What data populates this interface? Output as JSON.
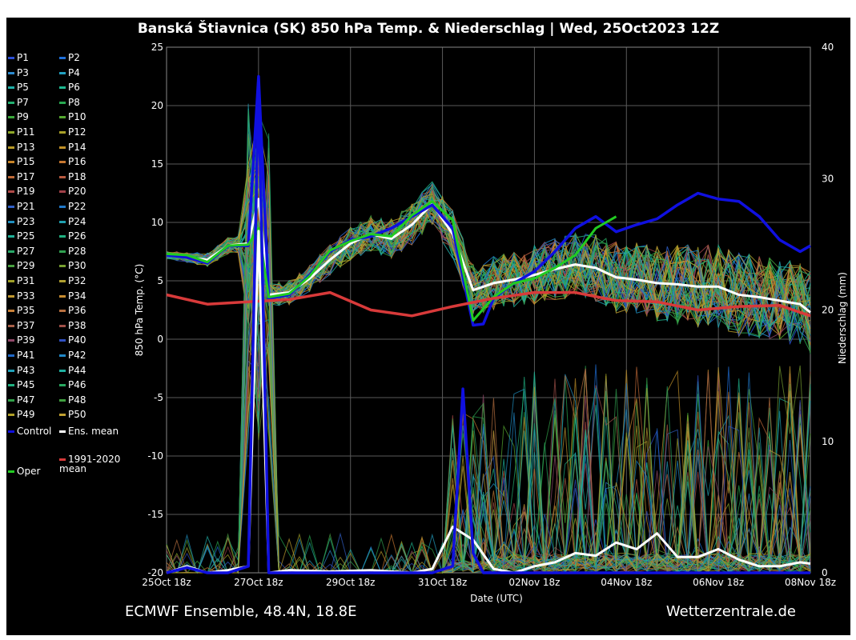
{
  "title": "Banská Štiavnica  (SK)  850 hPa Temp. & Niederschlag | Wed, 25Oct2023 12Z",
  "footer": {
    "model": "ECMWF Ensemble, 48.4N, 18.8E",
    "source": "Wetterzentrale.de"
  },
  "colors": {
    "background": "#000000",
    "grid": "#5a5a5a",
    "control": "#1010e0",
    "ens_mean": "#ffffff",
    "climate_mean": "#d83a3a",
    "oper": "#22cc22"
  },
  "legend": {
    "members": [
      "P1",
      "P2",
      "P3",
      "P4",
      "P5",
      "P6",
      "P7",
      "P8",
      "P9",
      "P10",
      "P11",
      "P12",
      "P13",
      "P14",
      "P15",
      "P16",
      "P17",
      "P18",
      "P19",
      "P20",
      "P21",
      "P22",
      "P23",
      "P24",
      "P25",
      "P26",
      "P27",
      "P28",
      "P29",
      "P30",
      "P31",
      "P32",
      "P33",
      "P34",
      "P35",
      "P36",
      "P37",
      "P38",
      "P39",
      "P40",
      "P41",
      "P42",
      "P43",
      "P44",
      "P45",
      "P46",
      "P47",
      "P48",
      "P49",
      "P50"
    ],
    "member_colors": [
      "#2c4fd6",
      "#1f6fd8",
      "#2b8ad0",
      "#22a0c0",
      "#20b0a8",
      "#1fb890",
      "#22b070",
      "#28a850",
      "#3aa83a",
      "#55a830",
      "#8ea828",
      "#a8a028",
      "#b89a28",
      "#c09028",
      "#c88428",
      "#c87830",
      "#c06a38",
      "#b85a40",
      "#b04a48",
      "#a04048",
      "#3060c8",
      "#2078c8",
      "#2090c0",
      "#20a0b0",
      "#20b098",
      "#20b080",
      "#28a868",
      "#30a050",
      "#48a040",
      "#78a030",
      "#a0a028",
      "#b0a030",
      "#c09830",
      "#c88c30",
      "#c88038",
      "#b87040",
      "#a86048",
      "#a05048",
      "#904868",
      "#3050c0",
      "#2068c8",
      "#2088c8",
      "#20a0b8",
      "#20b0a0",
      "#20b080",
      "#28a860",
      "#30a048",
      "#40a040",
      "#b0a028",
      "#c0a030"
    ],
    "control_label": "Control",
    "ens_mean_label": "Ens. mean",
    "climate_label": "1991-2020\nmean",
    "oper_label": "Oper"
  },
  "chart_data": {
    "type": "line",
    "title": "Banská Štiavnica  (SK)  850 hPa Temp. & Niederschlag | Wed, 25Oct2023 12Z",
    "xlabel": "Date (UTC)",
    "ylabel": "850 hPa Temp. (°C)",
    "ylabel_right": "Niederschlag (mm)",
    "x_ticks": [
      "25Oct 18z",
      "27Oct 18z",
      "29Oct 18z",
      "31Oct 18z",
      "02Nov 18z",
      "04Nov 18z",
      "06Nov 18z",
      "08Nov 18z"
    ],
    "xlim": [
      0,
      15.75
    ],
    "ylim": [
      -20,
      25
    ],
    "y_ticks": [
      -20,
      -15,
      -10,
      -5,
      0,
      5,
      10,
      15,
      20,
      25
    ],
    "ylim_right": [
      0,
      40
    ],
    "y_ticks_right": [
      0,
      10,
      20,
      30,
      40
    ],
    "grid": true,
    "temperature_series": [
      {
        "name": "Ens. mean",
        "x": [
          0,
          0.5,
          1,
          1.5,
          2,
          2.25,
          2.5,
          3,
          3.5,
          4,
          4.5,
          5,
          5.5,
          6,
          6.5,
          7,
          7.5,
          8,
          8.5,
          9,
          9.5,
          10,
          10.5,
          11,
          11.5,
          12,
          12.5,
          13,
          13.5,
          14,
          14.5,
          15,
          15.5,
          15.75
        ],
        "y": [
          7.2,
          7,
          6.8,
          8,
          8.2,
          12,
          3.8,
          4,
          5.2,
          6.8,
          8.2,
          9,
          8.6,
          9.8,
          11.6,
          9,
          4.2,
          4.8,
          5.1,
          5.5,
          6,
          6.4,
          6.1,
          5.3,
          5.1,
          4.8,
          4.7,
          4.5,
          4.5,
          3.8,
          3.6,
          3.3,
          3,
          2.3
        ]
      },
      {
        "name": "Control",
        "x": [
          0,
          0.5,
          1,
          1.5,
          2,
          2.25,
          2.5,
          3,
          3.5,
          4,
          4.5,
          5,
          5.5,
          6,
          6.5,
          7,
          7.5,
          7.75,
          8,
          8.5,
          9,
          9.5,
          10,
          10.5,
          11,
          11.5,
          12,
          12.5,
          13,
          13.5,
          14,
          14.5,
          15,
          15.5,
          15.75
        ],
        "y": [
          7.2,
          7,
          6.5,
          8,
          8,
          22.5,
          3.5,
          3.8,
          5.5,
          7.5,
          8.5,
          8.8,
          9.5,
          10.5,
          11.5,
          9.5,
          1.2,
          1.3,
          3.5,
          4.8,
          5.8,
          7.5,
          9.5,
          10.5,
          9.2,
          9.8,
          10.3,
          11.5,
          12.5,
          12,
          11.8,
          10.5,
          8.5,
          7.5,
          8
        ]
      },
      {
        "name": "Oper",
        "x": [
          0,
          0.5,
          1,
          1.5,
          2,
          2.25,
          2.5,
          3,
          3.5,
          4,
          4.5,
          5,
          5.5,
          6,
          6.5,
          7,
          7.5,
          8,
          8.5,
          9,
          9.5,
          10,
          10.5,
          11
        ],
        "y": [
          7.3,
          7.2,
          6.6,
          8,
          8.1,
          9.5,
          3.6,
          3.9,
          5.4,
          7.6,
          8.4,
          9,
          8.8,
          10.6,
          11.8,
          10.2,
          1.6,
          3.6,
          4.8,
          5.2,
          6.1,
          7.2,
          9.5,
          10.5
        ]
      },
      {
        "name": "1991-2020 mean",
        "x": [
          0,
          1,
          2,
          3,
          4,
          5,
          6,
          7,
          8,
          9,
          10,
          11,
          12,
          13,
          14,
          15,
          15.75
        ],
        "y": [
          3.8,
          3,
          3.2,
          3.4,
          4,
          2.5,
          2,
          2.8,
          3.5,
          4,
          4,
          3.3,
          3.2,
          2.5,
          2.8,
          2.9,
          2
        ]
      }
    ],
    "precipitation_series": [
      {
        "name": "Ens. mean",
        "x": [
          0,
          0.5,
          1,
          1.5,
          2,
          2.25,
          2.5,
          3,
          4,
          5,
          6,
          6.5,
          7,
          7.5,
          8,
          8.5,
          9,
          9.5,
          10,
          10.5,
          11,
          11.5,
          12,
          12.5,
          13,
          13.5,
          14,
          14.5,
          15,
          15.5,
          15.75
        ],
        "y": [
          0,
          0.5,
          0,
          0.2,
          0.5,
          26,
          0,
          0.2,
          0.1,
          0.2,
          0,
          0.3,
          3.5,
          2.5,
          0.3,
          0,
          0.5,
          0.8,
          1.5,
          1.3,
          2.3,
          1.8,
          3,
          1.2,
          1.2,
          1.8,
          1,
          0.5,
          0.5,
          0.8,
          0.7
        ]
      },
      {
        "name": "Control",
        "x": [
          0,
          0.5,
          1,
          1.5,
          2,
          2.25,
          2.5,
          3,
          4,
          5,
          6,
          6.5,
          7,
          7.25,
          7.5,
          7.75,
          8,
          9,
          10,
          11,
          12,
          13,
          14,
          15,
          15.75
        ],
        "y": [
          0,
          0.4,
          0,
          0,
          0.5,
          37,
          0,
          0,
          0,
          0,
          0,
          0,
          0.5,
          14,
          1.5,
          0,
          0,
          0,
          0,
          0,
          0,
          0,
          0,
          0,
          0
        ]
      }
    ]
  }
}
